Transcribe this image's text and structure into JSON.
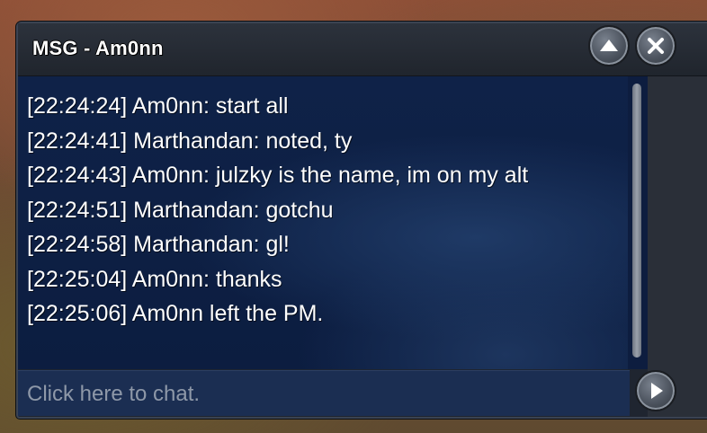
{
  "window": {
    "title": "MSG - Am0nn"
  },
  "buttons": {
    "minimize_icon": "chevron-up-icon",
    "close_icon": "close-icon",
    "send_icon": "play-arrow-icon"
  },
  "messages": [
    "[22:24:24] Am0nn: start all",
    "[22:24:41] Marthandan: noted, ty",
    "[22:24:43] Am0nn: julzky is the name, im on my alt",
    "[22:24:51] Marthandan: gotchu",
    "[22:24:58] Marthandan: gl!",
    "[22:25:04] Am0nn: thanks",
    "[22:25:06] Am0nn left the PM."
  ],
  "input": {
    "placeholder": "Click here to chat.",
    "value": ""
  },
  "colors": {
    "chat_background": "#0f2248",
    "titlebar": "#2c323c",
    "text": "#ffffff"
  }
}
